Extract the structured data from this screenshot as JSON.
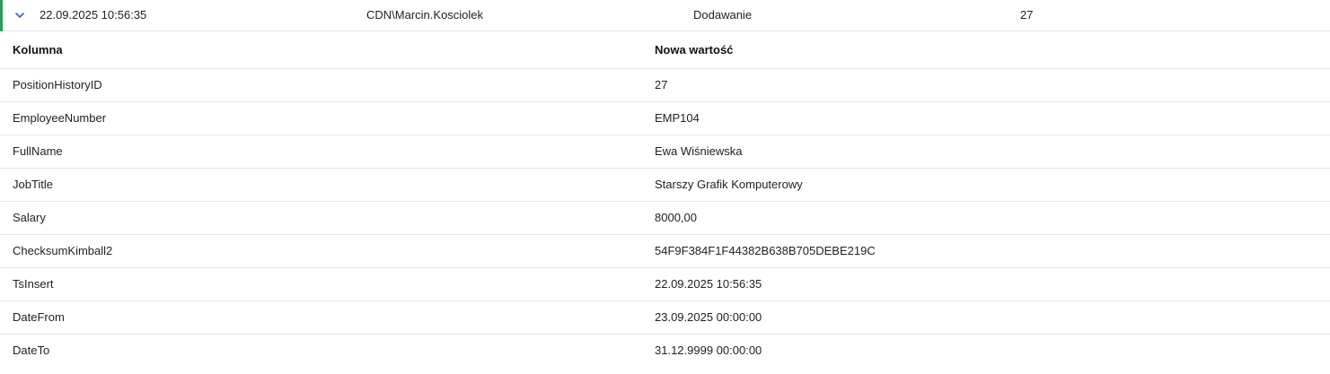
{
  "colors": {
    "accent": "#2e9b57",
    "chevron": "#3b5bdb",
    "divider": "#e6e6e6"
  },
  "summary": {
    "expand_icon": "chevron-down-icon",
    "timestamp": "22.09.2025 10:56:35",
    "user": "CDN\\Marcin.Kosciolek",
    "operation": "Dodawanie",
    "record_id": "27"
  },
  "details": {
    "headers": {
      "column": "Kolumna",
      "new_value": "Nowa wartość"
    },
    "rows": [
      {
        "column": "PositionHistoryID",
        "value": "27"
      },
      {
        "column": "EmployeeNumber",
        "value": "EMP104"
      },
      {
        "column": "FullName",
        "value": "Ewa Wiśniewska"
      },
      {
        "column": "JobTitle",
        "value": "Starszy Grafik Komputerowy"
      },
      {
        "column": "Salary",
        "value": "8000,00"
      },
      {
        "column": "ChecksumKimball2",
        "value": "54F9F384F1F44382B638B705DEBE219C"
      },
      {
        "column": "TsInsert",
        "value": "22.09.2025 10:56:35"
      },
      {
        "column": "DateFrom",
        "value": "23.09.2025 00:00:00"
      },
      {
        "column": "DateTo",
        "value": "31.12.9999 00:00:00"
      }
    ]
  }
}
